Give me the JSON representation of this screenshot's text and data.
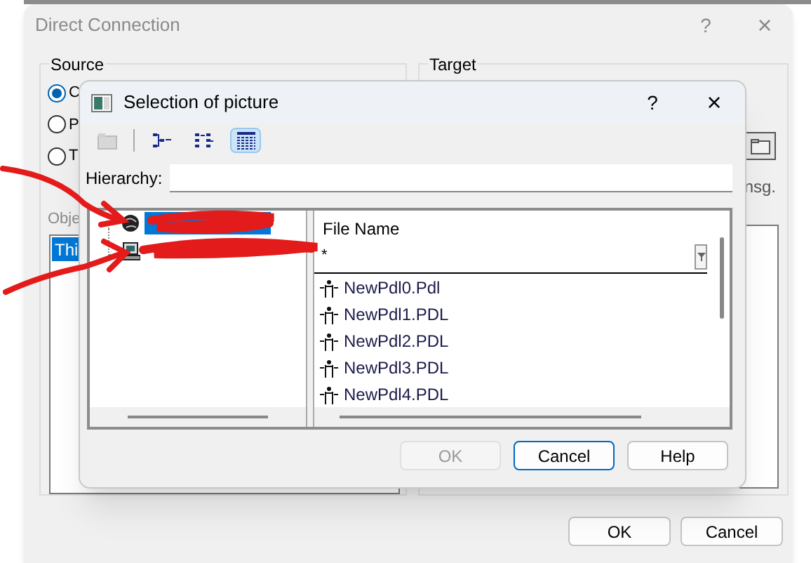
{
  "back_dialog": {
    "title": "Direct Connection",
    "help": "?",
    "close": "×",
    "source": {
      "label": "Source",
      "options": [
        {
          "label": "C",
          "selected": true
        },
        {
          "label": "P",
          "selected": false
        },
        {
          "label": "T",
          "selected": false
        }
      ],
      "objects_label": "Obje",
      "objects": [
        {
          "label": "Thi",
          "selected": true
        }
      ]
    },
    "target": {
      "label": "Target",
      "note": "nsg."
    },
    "buttons": [
      "OK",
      "Cancel"
    ]
  },
  "dialog": {
    "title": "Selection of picture",
    "help": "?",
    "close": "×",
    "toolbar": [
      {
        "kind": "folder",
        "disabled": true,
        "selected": false
      },
      {
        "kind": "tree",
        "disabled": false,
        "selected": false
      },
      {
        "kind": "list",
        "disabled": false,
        "selected": false
      },
      {
        "kind": "details",
        "disabled": false,
        "selected": true
      }
    ],
    "hierarchy_label": "Hierarchy:",
    "tree": [
      {
        "kind": "project",
        "selected": true
      },
      {
        "kind": "computer",
        "selected": false
      }
    ],
    "files": {
      "column": "File Name",
      "filter": "*",
      "rows": [
        "NewPdl0.Pdl",
        "NewPdl1.PDL",
        "NewPdl2.PDL",
        "NewPdl3.PDL",
        "NewPdl4.PDL"
      ]
    },
    "buttons": [
      {
        "label": "OK",
        "disabled": true,
        "default": false
      },
      {
        "label": "Cancel",
        "disabled": false,
        "default": true
      },
      {
        "label": "Help",
        "disabled": false,
        "default": false
      }
    ]
  }
}
